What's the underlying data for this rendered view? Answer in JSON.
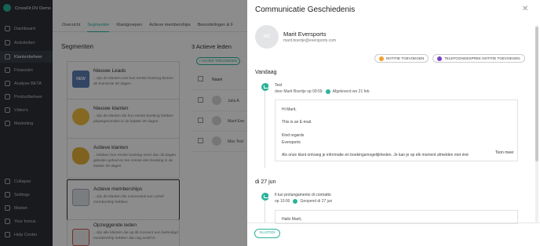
{
  "app": {
    "name": "CrossFit DV Demo"
  },
  "sidebar": {
    "items": [
      {
        "label": "Dashboard"
      },
      {
        "label": "Activiteiten"
      },
      {
        "label": "Klantenbeheer"
      },
      {
        "label": "Financiën"
      },
      {
        "label": "Analyse BETA"
      },
      {
        "label": "Productbeheer"
      },
      {
        "label": "Video's"
      },
      {
        "label": "Marketing"
      }
    ],
    "bottom": [
      {
        "label": "Collapse"
      },
      {
        "label": "Settings"
      },
      {
        "label": "Market"
      },
      {
        "label": "Your bonus"
      },
      {
        "label": "Help Center"
      }
    ]
  },
  "tabs": [
    "Overzicht",
    "Segmenten",
    "Klantgroepen",
    "Actieve memberships",
    "Beoordelingen & F"
  ],
  "segments": {
    "title": "Segmenten",
    "items": [
      {
        "title": "Nieuwe Leads",
        "desc": "...zijn de klanten met hun eerste boeking binnen de komende 30 dagen"
      },
      {
        "title": "Nieuwe klanten",
        "desc": "...zijn de klanten die hun eerste boeking hebben plaatsgevonden in de laatste 30 dagen."
      },
      {
        "title": "Actieve klanten",
        "desc": "...hebben hun eerste boeking meer dan 30 dagen geleden gehad en ten minste één boeking in de laatste 30 dagen"
      },
      {
        "title": "Actieve memberships",
        "desc": "...zijn de klanten die momenteel een actief membership hebben."
      },
      {
        "title": "Opzeggende leden",
        "desc": "...zijn alle klanten die op dit moment een beëindigd membership hebben dat nog actief is"
      }
    ]
  },
  "members": {
    "title": "3 Actieve leden",
    "filter_label": "+ FILTER TOEVOEGEN",
    "col_name": "Naam",
    "rows": [
      "Julia A",
      "Marit Eve",
      "Max Test"
    ]
  },
  "panel": {
    "title": "Communicatie Geschiedenis",
    "close": "✕",
    "contact": {
      "initials": "ME",
      "name": "Marit Eversports",
      "email": "marit.boertje@eversports.com"
    },
    "buttons": {
      "note": "NOTITIE TOEVOEGEN",
      "phone_note": "TELEFOONGESPREK NOTITIE TOEVOEGEN"
    },
    "day1": "Vandaag",
    "entry1": {
      "title": "Test",
      "meta": "door Marit Boertje op 09:59",
      "status": "Afgeleverd wo 21 feb",
      "lines": [
        "Hi Marit,",
        "This is an E-mail.",
        "Kind regards",
        "Eversports",
        "Als onze klant ontvang je informatie en boekingsmogelijkheden. Je kan je op elk moment afmelden met éné"
      ],
      "more": "Toon meer"
    },
    "day2": "di 27 jun",
    "entry2": {
      "title": "Il tuo prolungamento di contratto",
      "meta": "op 10:00",
      "status": "Geopend di 27 jun",
      "lines": [
        "Hallo Marit,"
      ]
    },
    "close_button": "SLUITEN"
  }
}
